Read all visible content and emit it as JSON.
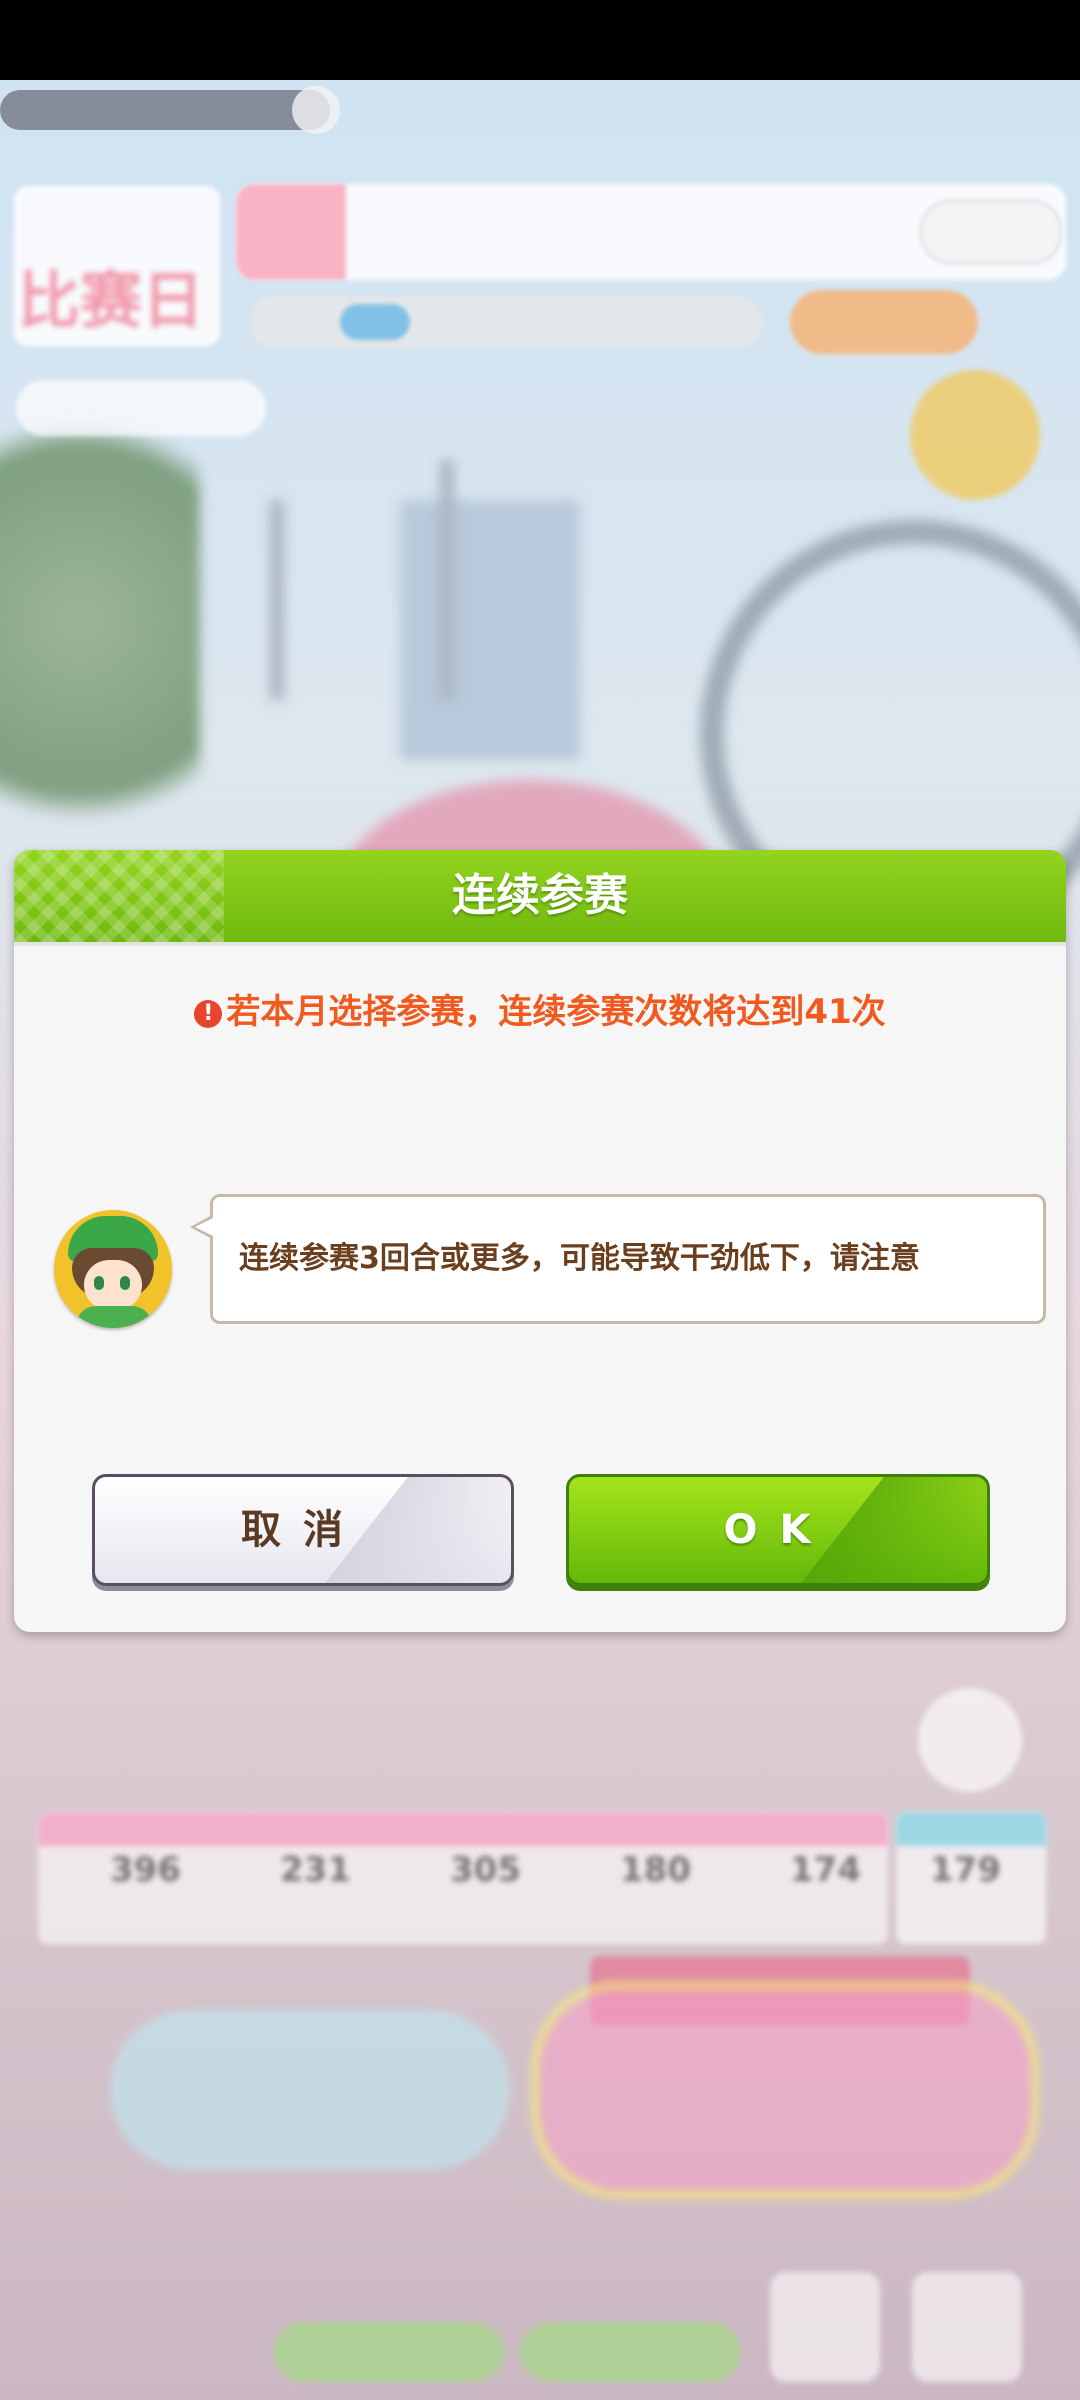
{
  "dialog": {
    "title": "连续参赛",
    "warning_icon": "exclamation-icon",
    "warning_text": "若本月选择参赛，连续参赛次数将达到41次",
    "message": "连续参赛3回合或更多，可能导致干劲低下，请注意",
    "cancel_label": "取消",
    "ok_label": "OK"
  },
  "background": {
    "calendar_label": "比赛日",
    "stats": [
      "396",
      "231",
      "305",
      "180",
      "174"
    ],
    "stats_right": "179"
  },
  "colors": {
    "header_green": "#7cc414",
    "warning_orange": "#f05a1e",
    "message_brown": "#6b3f1e",
    "ok_green": "#7ccf12"
  }
}
